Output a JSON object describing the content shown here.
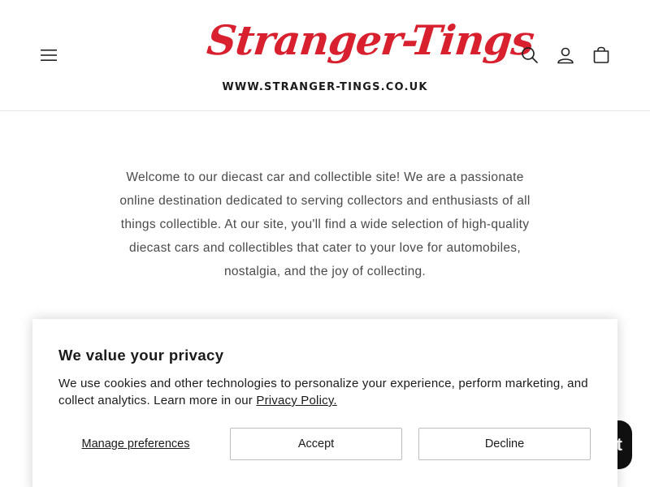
{
  "header": {
    "logo_script": "Stranger-Tings",
    "logo_url": "WWW.STRANGER-TINGS.CO.UK",
    "icons": [
      "menu-icon",
      "search-icon",
      "account-icon",
      "cart-icon"
    ],
    "brand_color": "#d8202e"
  },
  "intro": {
    "text": "Welcome to our diecast car and collectible site! We are a passionate online destination dedicated to serving collectors and enthusiasts of all things collectible. At our site, you'll find a wide selection of high-quality diecast cars and collectibles that cater to your love for automobiles, nostalgia, and the joy of collecting."
  },
  "chat": {
    "visible_text": "t"
  },
  "cookie_banner": {
    "title": "We value your privacy",
    "text": "We use cookies and other technologies to personalize your experience, perform marketing, and collect analytics. Learn more in our",
    "link_label": "Privacy Policy.",
    "manage_label": "Manage preferences",
    "accept_label": "Accept",
    "decline_label": "Decline"
  }
}
